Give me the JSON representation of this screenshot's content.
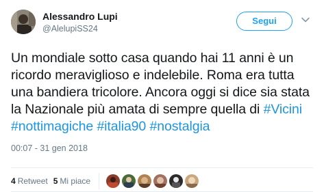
{
  "user": {
    "display_name": "Alessandro Lupi",
    "handle": "@AlelupiSS24",
    "avatar_icon": "user-avatar-photo"
  },
  "follow_button": {
    "label": "Segui"
  },
  "menu_icon": "chevron-down-icon",
  "tweet": {
    "text_parts": [
      "Un mondiale sotto casa quando hai 11 anni è un ricordo meraviglioso e indelebile. Roma era tutta una bandiera tricolore. Ancora oggi si dice sia stata la Nazionale più amata di sempre quella di ",
      "#Vicini",
      "#nottimagiche",
      "#italia90",
      "#nostalgia"
    ],
    "timestamp": "00:07 - 31 gen 2018"
  },
  "stats": {
    "retweets_count": "4",
    "retweets_label": "Retweet",
    "likes_count": "5",
    "likes_label": "Mi piace"
  },
  "likers": [
    {
      "icon": "liker-avatar-1",
      "color": "#8a3b2a"
    },
    {
      "icon": "liker-avatar-2",
      "color": "#4a6a3a"
    },
    {
      "icon": "liker-avatar-3",
      "color": "#b0814f"
    },
    {
      "icon": "liker-avatar-4",
      "color": "#a07060"
    },
    {
      "icon": "liker-avatar-5",
      "color": "#2a2a2a"
    },
    {
      "icon": "liker-avatar-6",
      "color": "#c9a880"
    }
  ],
  "colors": {
    "accent": "#1da1f2",
    "hashtag": "#1b95e0",
    "muted": "#657786",
    "text": "#14171a"
  }
}
